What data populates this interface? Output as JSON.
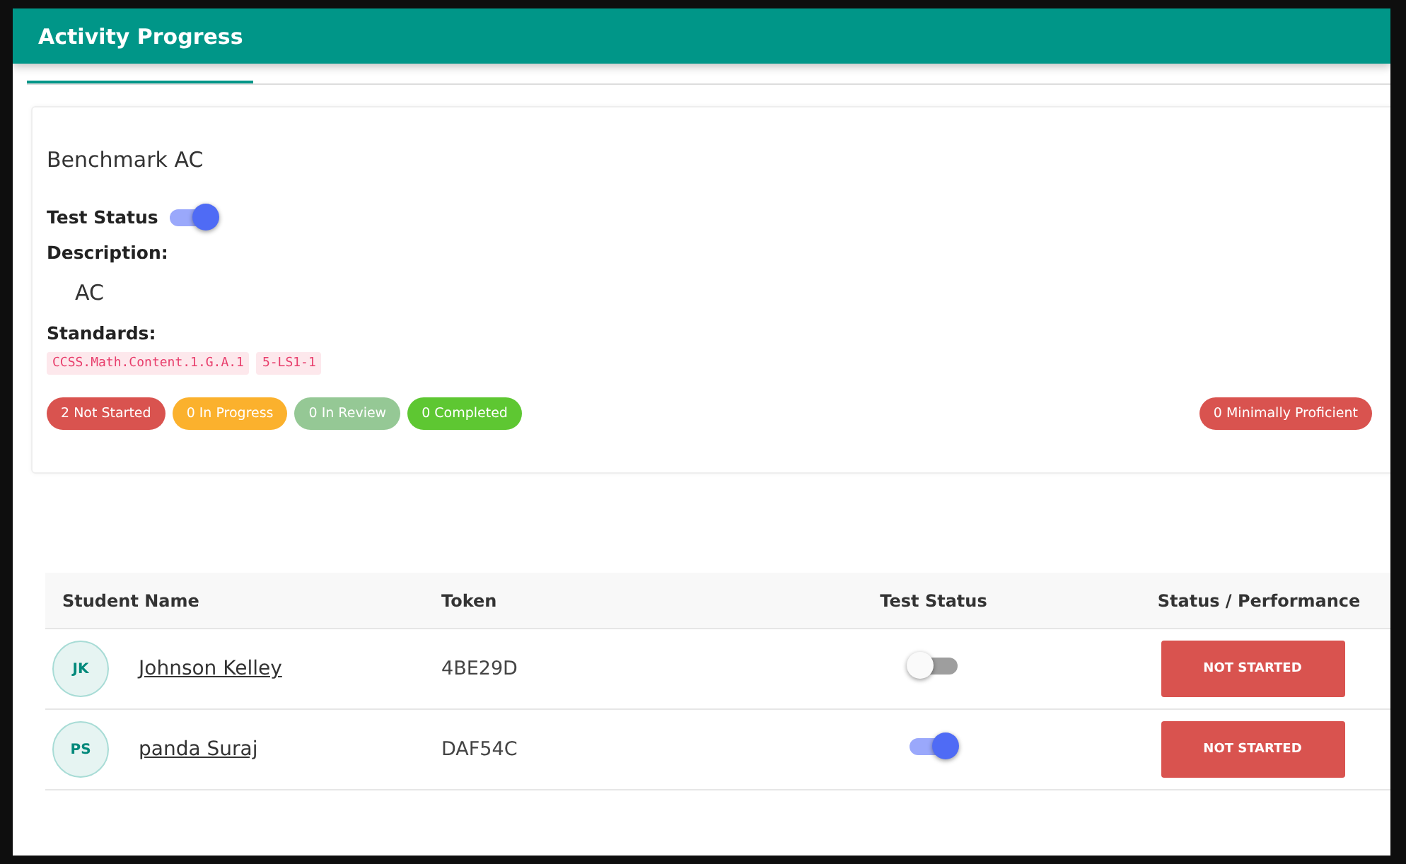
{
  "header": {
    "title": "Activity Progress"
  },
  "activity": {
    "name": "Benchmark AC",
    "test_status": {
      "label": "Test Status",
      "on": true
    },
    "description_label": "Description:",
    "description": "AC",
    "standards_label": "Standards:",
    "standards": [
      "CCSS.Math.Content.1.G.A.1",
      "5-LS1-1"
    ]
  },
  "status_counts": [
    {
      "label": "2 Not Started",
      "color": "#d9534f"
    },
    {
      "label": "0 In Progress",
      "color": "#fbb12d"
    },
    {
      "label": "0 In Review",
      "color": "#95c895"
    },
    {
      "label": "0 Completed",
      "color": "#5ec732"
    }
  ],
  "proficiency": {
    "label": "0 Minimally Proficient",
    "color": "#d9534f"
  },
  "table": {
    "columns": [
      "Student Name",
      "Token",
      "Test Status",
      "Status / Performance"
    ],
    "rows": [
      {
        "initials": "JK",
        "name": "Johnson Kelley",
        "token": "4BE29D",
        "test_on": false,
        "status": "NOT STARTED"
      },
      {
        "initials": "PS",
        "name": "panda Suraj",
        "token": "DAF54C",
        "test_on": true,
        "status": "NOT STARTED"
      }
    ]
  }
}
